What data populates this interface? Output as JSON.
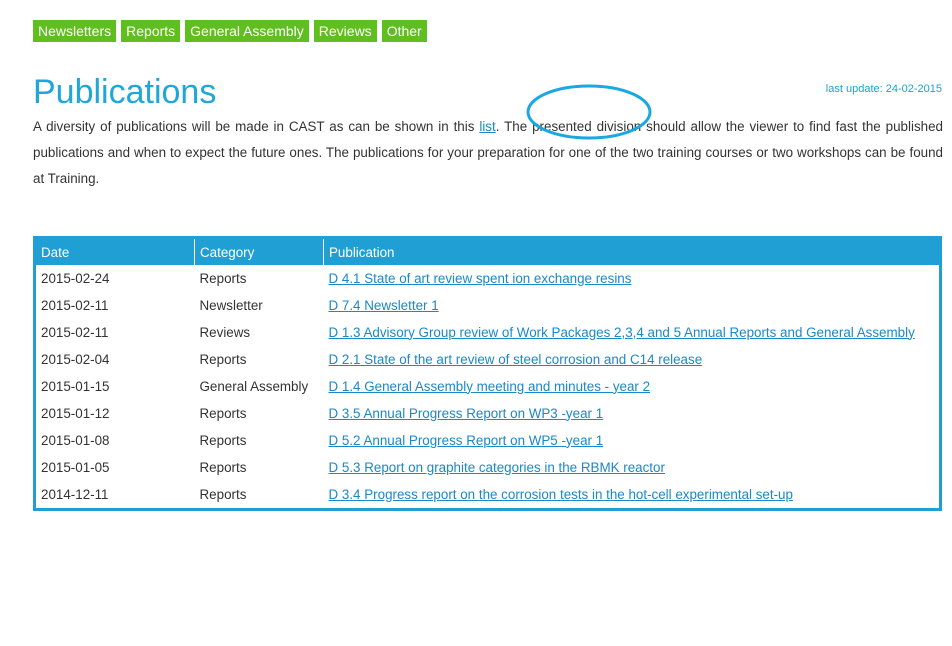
{
  "tabs": [
    "Newsletters",
    "Reports",
    "General Assembly",
    "Reviews",
    "Other"
  ],
  "page": {
    "title": "Publications",
    "last_update": "last update: 24-02-2015"
  },
  "intro": {
    "before_link": "A diversity of publications will be made in CAST as can be shown in this ",
    "link": "list",
    "after_link": ". The presented division should allow the viewer to find fast the published publications and when to expect the future ones. The publications for your preparation for one of the two training courses or two workshops can be found at Training."
  },
  "table": {
    "headers": [
      "Date",
      "Category",
      "Publication"
    ],
    "rows": [
      {
        "date": "2015-02-24",
        "category": "Reports",
        "publication": "D 4.1 State of art review spent ion exchange resins"
      },
      {
        "date": "2015-02-11",
        "category": "Newsletter",
        "publication": "D 7.4 Newsletter 1"
      },
      {
        "date": "2015-02-11",
        "category": "Reviews",
        "publication": "D 1.3 Advisory Group review of Work Packages 2,3,4 and 5 Annual Reports and General Assembly"
      },
      {
        "date": "2015-02-04",
        "category": "Reports",
        "publication": "D 2.1 State of the art review of steel corrosion and C14 release"
      },
      {
        "date": "2015-01-15",
        "category": "General Assembly",
        "publication": "D 1.4 General Assembly meeting and minutes - year 2"
      },
      {
        "date": "2015-01-12",
        "category": "Reports",
        "publication": "D 3.5 Annual Progress Report on WP3 -year 1"
      },
      {
        "date": "2015-01-08",
        "category": "Reports",
        "publication": "D 5.2 Annual Progress Report on WP5 -year 1"
      },
      {
        "date": "2015-01-05",
        "category": "Reports",
        "publication": "D 5.3 Report on graphite categories in the RBMK reactor"
      },
      {
        "date": "2014-12-11",
        "category": "Reports",
        "publication": "D 3.4 Progress report on the corrosion tests in the hot-cell experimental set-up"
      }
    ]
  },
  "colors": {
    "tab_green": "#5fbf1f",
    "accent_blue": "#1f9fd4",
    "link_blue": "#1a88c9"
  }
}
